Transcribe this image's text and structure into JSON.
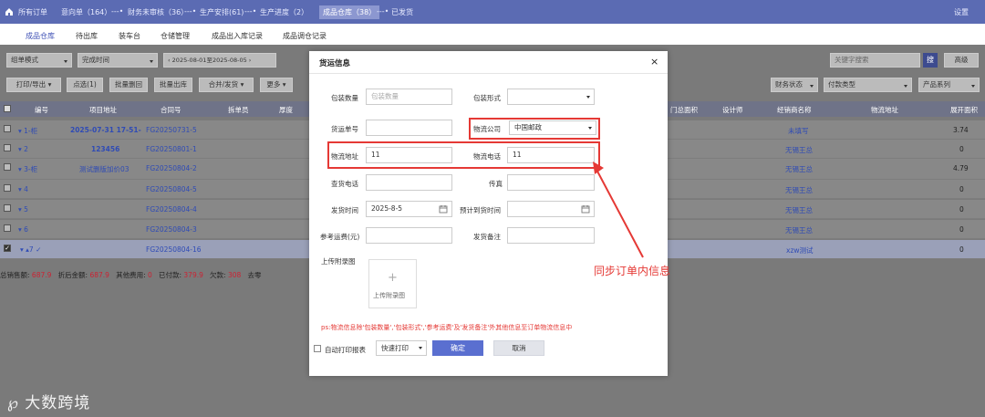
{
  "nav": {
    "items": [
      "所有订单",
      "意向单（164）",
      "财务未审核（36）",
      "生产安排(61)",
      "生产进度（2）",
      "成品仓库（38）",
      "已发货"
    ],
    "settings": "设置"
  },
  "subnav": {
    "tabs": [
      "成品仓库",
      "待出库",
      "装车台",
      "仓储管理",
      "成品出入库记录",
      "成品调仓记录"
    ]
  },
  "toolbar": {
    "mode": "组单模式",
    "time_type": "完成时间",
    "date_range": "2025-08-01至2025-08-05",
    "keyword_placeholder": "关键字搜索",
    "search": "搜",
    "advanced": "高级",
    "buttons": [
      "打印/导出",
      "点选(1)",
      "批量删回",
      "批量出库",
      "合并/发货",
      "更多"
    ],
    "right_selects": [
      "财务状态",
      "付款类型",
      "产品系列"
    ]
  },
  "table": {
    "headers": [
      "编号",
      "项目地址",
      "合同号",
      "拆单员",
      "厚度",
      "门总面积",
      "设计师",
      "经销商名称",
      "物流地址",
      "展开面积"
    ],
    "rows": [
      {
        "id": "1-柜",
        "project": "2025-07-31 17-51-",
        "contract": "FG20250731-5",
        "dealer": "未填写",
        "area": "3.74"
      },
      {
        "id": "2",
        "project": "123456",
        "contract": "FG20250801-1",
        "dealer": "无锡王总",
        "area": "0"
      },
      {
        "id": "3-柜",
        "project": "测试删版加价03",
        "contract": "FG20250804-2",
        "dealer": "无锡王总",
        "area": "4.79"
      },
      {
        "id": "4",
        "project": "",
        "contract": "FG20250804-5",
        "dealer": "无锡王总",
        "area": "0"
      },
      {
        "id": "5",
        "project": "",
        "contract": "FG20250804-4",
        "dealer": "无锡王总",
        "area": "0"
      },
      {
        "id": "6",
        "project": "",
        "contract": "FG20250804-3",
        "dealer": "无锡王总",
        "area": "0"
      },
      {
        "id": "7",
        "project": "",
        "contract": "FG20250804-16",
        "dealer": "xzw测试",
        "area": "0"
      }
    ]
  },
  "summary": {
    "total_label": "总销售额:",
    "total": "687.9",
    "discount_label": "折后金额:",
    "discount": "687.9",
    "other_label": "其他费用:",
    "other": "0",
    "paid_label": "已付款:",
    "paid": "379.9",
    "owed_label": "欠款:",
    "owed": "308",
    "rest": "去零"
  },
  "modal": {
    "title": "货运信息",
    "close": "×",
    "fields": {
      "pack_qty_label": "包装数量",
      "pack_qty_placeholder": "包装数量",
      "pack_type_label": "包装形式",
      "pack_type_value": "",
      "waybill_label": "货运单号",
      "waybill_value": "",
      "carrier_label": "物流公司",
      "carrier_value": "中国邮政",
      "addr_label": "物流地址",
      "addr_value": "11",
      "phone_label": "物流电话",
      "phone_value": "11",
      "query_phone_label": "查货电话",
      "query_phone_value": "",
      "fax_label": "传真",
      "fax_value": "",
      "ship_time_label": "发货时间",
      "ship_time_value": "2025-8-5",
      "arrive_time_label": "预计到货时间",
      "arrive_time_value": "",
      "fee_label": "参考运费(元)",
      "fee_value": "",
      "ship_note_label": "发货备注",
      "ship_note_value": ""
    },
    "upload_label": "上传附录图",
    "upload_text": "上传附录图",
    "note": "ps:物流信息除'包装数量','包装形式','参考运费'及'发货备注'外其他信息至订单物流信息中",
    "auto_print_label": "自动打印报表",
    "print_mode": "快速打印",
    "confirm": "确定",
    "cancel": "取消"
  },
  "annotation": "同步订单内信息",
  "logo_text": "大数跨境",
  "colors": {
    "nav": "#5b6bb3",
    "primary": "#5a6fd0",
    "annotation": "#e53935"
  }
}
